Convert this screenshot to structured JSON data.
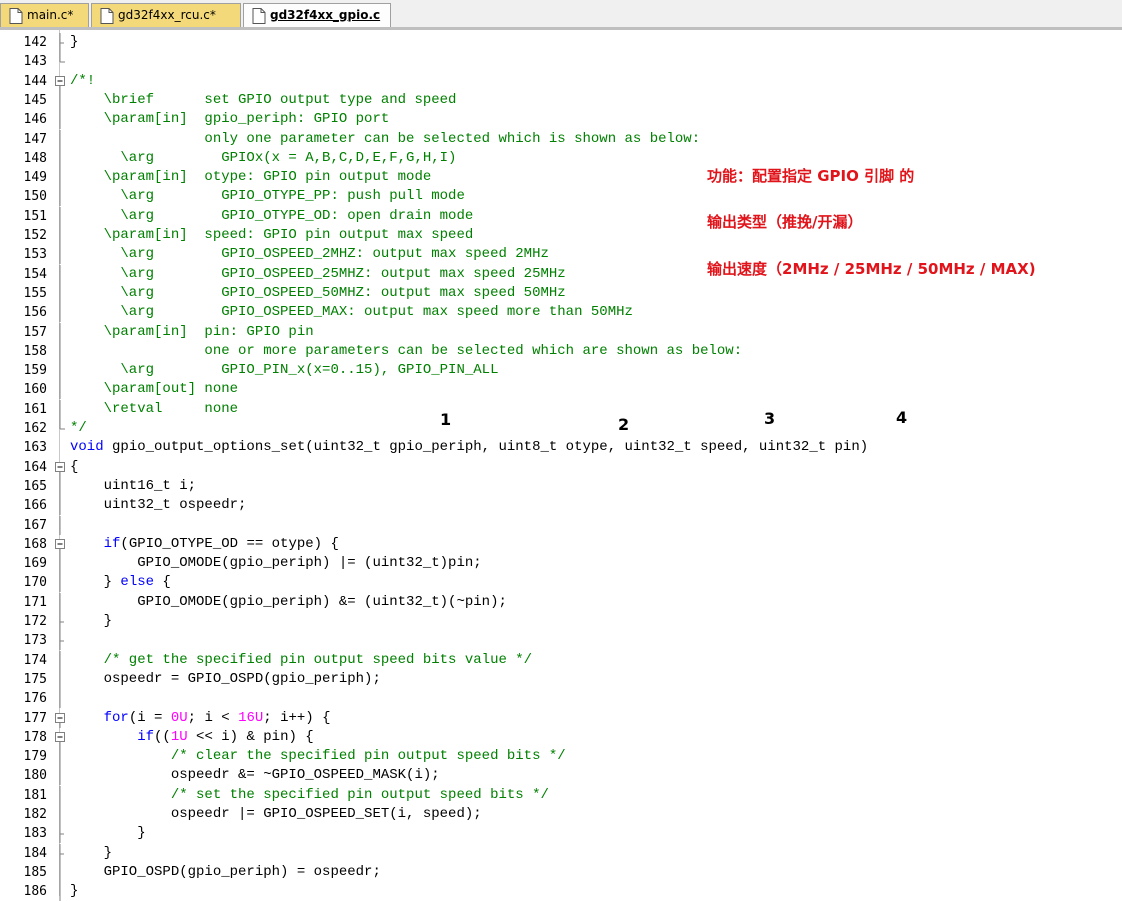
{
  "tabs": [
    {
      "label": "main.c*",
      "state": "modified"
    },
    {
      "label": "gd32f4xx_rcu.c*",
      "state": "modified"
    },
    {
      "label": "gd32f4xx_gpio.c",
      "state": "active"
    }
  ],
  "colors": {
    "comment": "#008000",
    "keyword": "#0000ff",
    "number": "#ff00ff",
    "annotation": "#e0141a",
    "modified_tab": "#f4d97a"
  },
  "lines": [
    {
      "n": "142",
      "fold": "end",
      "seg": [
        {
          "t": "}"
        }
      ]
    },
    {
      "n": "143",
      "fold": "corner",
      "seg": []
    },
    {
      "n": "144",
      "fold": "box",
      "seg": [
        {
          "t": "/*!",
          "c": "cmt"
        }
      ]
    },
    {
      "n": "145",
      "fold": "bar",
      "seg": [
        {
          "t": "    \\brief      set GPIO output type and speed",
          "c": "cmt"
        }
      ]
    },
    {
      "n": "146",
      "fold": "bar",
      "seg": [
        {
          "t": "    \\param[in]  gpio_periph: GPIO port",
          "c": "cmt"
        }
      ]
    },
    {
      "n": "147",
      "fold": "bar",
      "seg": [
        {
          "t": "                only one parameter can be selected which is shown as below:",
          "c": "cmt"
        }
      ]
    },
    {
      "n": "148",
      "fold": "bar",
      "seg": [
        {
          "t": "      \\arg        GPIOx(x = A,B,C,D,E,F,G,H,I)",
          "c": "cmt"
        }
      ]
    },
    {
      "n": "149",
      "fold": "bar",
      "seg": [
        {
          "t": "    \\param[in]  otype: GPIO pin output mode",
          "c": "cmt"
        }
      ]
    },
    {
      "n": "150",
      "fold": "bar",
      "seg": [
        {
          "t": "      \\arg        GPIO_OTYPE_PP: push pull mode",
          "c": "cmt"
        }
      ]
    },
    {
      "n": "151",
      "fold": "bar",
      "seg": [
        {
          "t": "      \\arg        GPIO_OTYPE_OD: open drain mode",
          "c": "cmt"
        }
      ]
    },
    {
      "n": "152",
      "fold": "bar",
      "seg": [
        {
          "t": "    \\param[in]  speed: GPIO pin output max speed",
          "c": "cmt"
        }
      ]
    },
    {
      "n": "153",
      "fold": "bar",
      "seg": [
        {
          "t": "      \\arg        GPIO_OSPEED_2MHZ: output max speed 2MHz",
          "c": "cmt"
        }
      ]
    },
    {
      "n": "154",
      "fold": "bar",
      "seg": [
        {
          "t": "      \\arg        GPIO_OSPEED_25MHZ: output max speed 25MHz",
          "c": "cmt"
        }
      ]
    },
    {
      "n": "155",
      "fold": "bar",
      "seg": [
        {
          "t": "      \\arg        GPIO_OSPEED_50MHZ: output max speed 50MHz",
          "c": "cmt"
        }
      ]
    },
    {
      "n": "156",
      "fold": "bar",
      "seg": [
        {
          "t": "      \\arg        GPIO_OSPEED_MAX: output max speed more than 50MHz",
          "c": "cmt"
        }
      ]
    },
    {
      "n": "157",
      "fold": "bar",
      "seg": [
        {
          "t": "    \\param[in]  pin: GPIO pin",
          "c": "cmt"
        }
      ]
    },
    {
      "n": "158",
      "fold": "bar",
      "seg": [
        {
          "t": "                one or more parameters can be selected which are shown as below:",
          "c": "cmt"
        }
      ]
    },
    {
      "n": "159",
      "fold": "bar",
      "seg": [
        {
          "t": "      \\arg        GPIO_PIN_x(x=0..15), GPIO_PIN_ALL",
          "c": "cmt"
        }
      ]
    },
    {
      "n": "160",
      "fold": "bar",
      "seg": [
        {
          "t": "    \\param[out] none",
          "c": "cmt"
        }
      ]
    },
    {
      "n": "161",
      "fold": "bar",
      "seg": [
        {
          "t": "    \\retval     none",
          "c": "cmt"
        }
      ]
    },
    {
      "n": "162",
      "fold": "corner",
      "seg": [
        {
          "t": "*/",
          "c": "cmt"
        }
      ]
    },
    {
      "n": "163",
      "fold": "",
      "seg": [
        {
          "t": "void",
          "c": "kw"
        },
        {
          "t": " gpio_output_options_set(uint32_t gpio_periph, uint8_t otype, uint32_t speed, uint32_t pin)"
        }
      ]
    },
    {
      "n": "164",
      "fold": "box",
      "seg": [
        {
          "t": "{"
        }
      ]
    },
    {
      "n": "165",
      "fold": "bar",
      "seg": [
        {
          "t": "    uint16_t i;"
        }
      ]
    },
    {
      "n": "166",
      "fold": "bar",
      "seg": [
        {
          "t": "    uint32_t ospeedr;"
        }
      ]
    },
    {
      "n": "167",
      "fold": "bar",
      "seg": []
    },
    {
      "n": "168",
      "fold": "box",
      "seg": [
        {
          "t": "    "
        },
        {
          "t": "if",
          "c": "kw"
        },
        {
          "t": "(GPIO_OTYPE_OD == otype) {"
        }
      ]
    },
    {
      "n": "169",
      "fold": "bar",
      "seg": [
        {
          "t": "        GPIO_OMODE(gpio_periph) |= (uint32_t)pin;"
        }
      ]
    },
    {
      "n": "170",
      "fold": "bar",
      "seg": [
        {
          "t": "    } "
        },
        {
          "t": "else",
          "c": "kw"
        },
        {
          "t": " {"
        }
      ]
    },
    {
      "n": "171",
      "fold": "bar",
      "seg": [
        {
          "t": "        GPIO_OMODE(gpio_periph) &= (uint32_t)(~pin);"
        }
      ]
    },
    {
      "n": "172",
      "fold": "end",
      "seg": [
        {
          "t": "    }"
        }
      ]
    },
    {
      "n": "173",
      "fold": "end",
      "seg": []
    },
    {
      "n": "174",
      "fold": "bar",
      "seg": [
        {
          "t": "    /* get the specified pin output speed bits value */",
          "c": "cmt"
        }
      ]
    },
    {
      "n": "175",
      "fold": "bar",
      "seg": [
        {
          "t": "    ospeedr = GPIO_OSPD(gpio_periph);"
        }
      ]
    },
    {
      "n": "176",
      "fold": "bar",
      "seg": []
    },
    {
      "n": "177",
      "fold": "box",
      "seg": [
        {
          "t": "    "
        },
        {
          "t": "for",
          "c": "kw"
        },
        {
          "t": "(i = "
        },
        {
          "t": "0U",
          "c": "num"
        },
        {
          "t": "; i < "
        },
        {
          "t": "16U",
          "c": "num"
        },
        {
          "t": "; i++) {"
        }
      ]
    },
    {
      "n": "178",
      "fold": "box",
      "seg": [
        {
          "t": "        "
        },
        {
          "t": "if",
          "c": "kw"
        },
        {
          "t": "(("
        },
        {
          "t": "1U",
          "c": "num"
        },
        {
          "t": " << i) & pin) {"
        }
      ]
    },
    {
      "n": "179",
      "fold": "bar",
      "seg": [
        {
          "t": "            /* clear the specified pin output speed bits */",
          "c": "cmt"
        }
      ]
    },
    {
      "n": "180",
      "fold": "bar",
      "seg": [
        {
          "t": "            ospeedr &= ~GPIO_OSPEED_MASK(i);"
        }
      ]
    },
    {
      "n": "181",
      "fold": "bar",
      "seg": [
        {
          "t": "            /* set the specified pin output speed bits */",
          "c": "cmt"
        }
      ]
    },
    {
      "n": "182",
      "fold": "bar",
      "seg": [
        {
          "t": "            ospeedr |= GPIO_OSPEED_SET(i, speed);"
        }
      ]
    },
    {
      "n": "183",
      "fold": "end",
      "seg": [
        {
          "t": "        }"
        }
      ]
    },
    {
      "n": "184",
      "fold": "end",
      "seg": [
        {
          "t": "    }"
        }
      ]
    },
    {
      "n": "185",
      "fold": "bar",
      "seg": [
        {
          "t": "    GPIO_OSPD(gpio_periph) = ospeedr;"
        }
      ]
    },
    {
      "n": "186",
      "fold": "bar",
      "seg": [
        {
          "t": "}"
        }
      ]
    }
  ],
  "annotations": {
    "line1": "功能：配置指定 GPIO 引脚 的",
    "line2": "输出类型（推挽/开漏）",
    "line3": "输出速度（2MHz / 25MHz / 50MHz / MAX)"
  },
  "param_markers": [
    "1",
    "2",
    "3",
    "4"
  ]
}
